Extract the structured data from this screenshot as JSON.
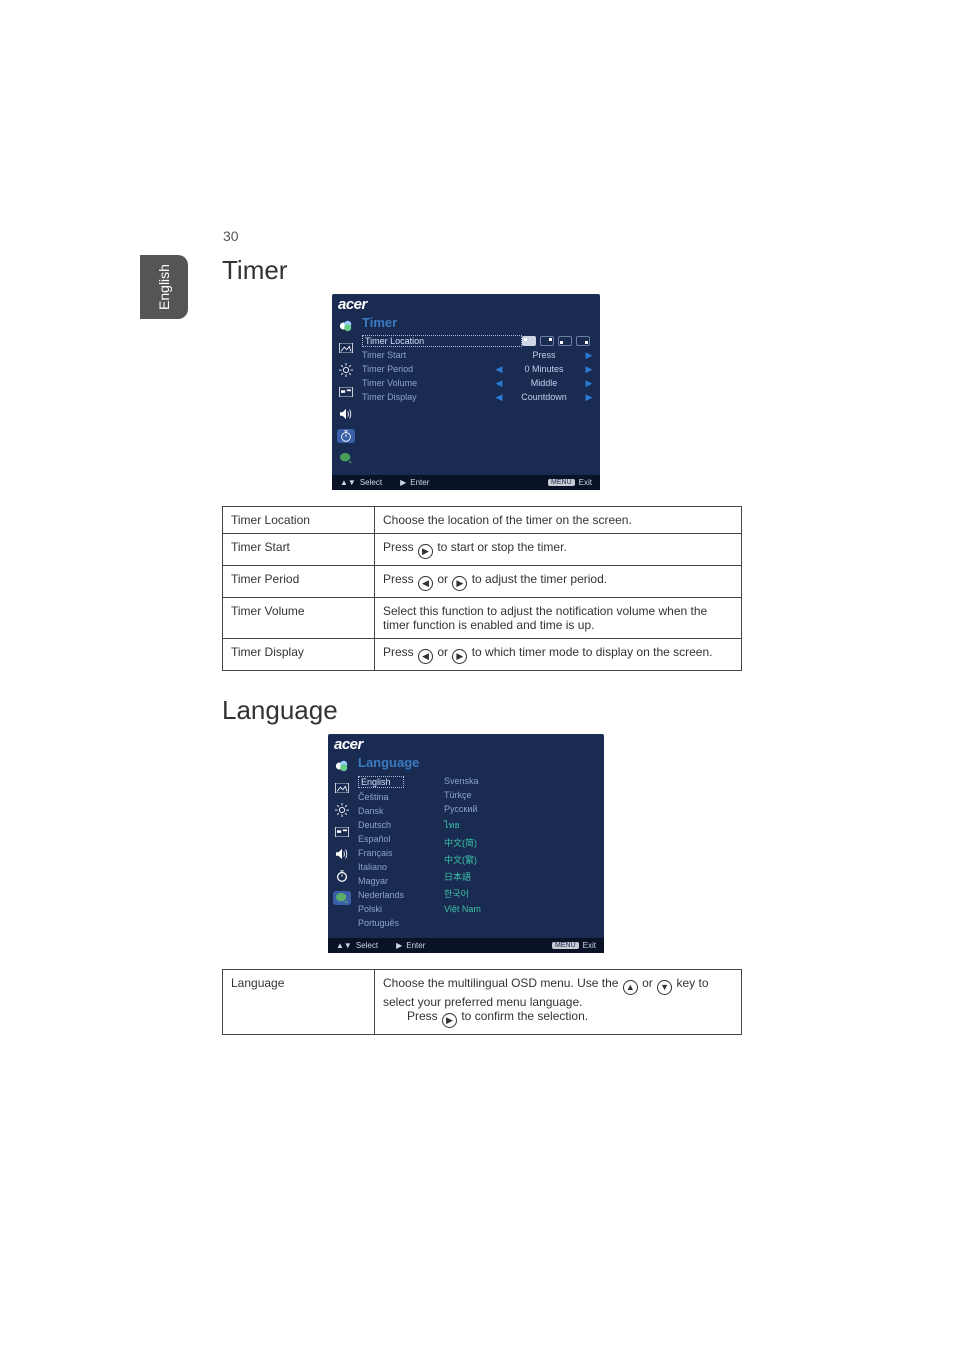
{
  "page_number": "30",
  "side_tab": "English",
  "osd_brand": "acer",
  "osd_footer": {
    "select": "Select",
    "enter": "Enter",
    "menu_badge": "MENU",
    "exit": "Exit"
  },
  "timer": {
    "heading": "Timer",
    "osd_title": "Timer",
    "rows": [
      {
        "label": "Timer Location",
        "value_type": "screens"
      },
      {
        "label": "Timer Start",
        "value": "Press",
        "arrows": false,
        "right_only": true
      },
      {
        "label": "Timer Period",
        "value": "0  Minutes",
        "arrows": true
      },
      {
        "label": "Timer Volume",
        "value": "Middle",
        "arrows": true
      },
      {
        "label": "Timer Display",
        "value": "Countdown",
        "arrows": true
      }
    ],
    "table": [
      {
        "k": "Timer Location",
        "v": "Choose the location of the timer on the screen."
      },
      {
        "k": "Timer Start",
        "v_pre": "Press ",
        "v_icon": "▶",
        "v_post": " to start or stop the timer."
      },
      {
        "k": "Timer Period",
        "v_pre": "Press ",
        "v_icon1": "◀",
        "v_mid": " or ",
        "v_icon2": "▶",
        "v_post": " to adjust the timer period."
      },
      {
        "k": "Timer Volume",
        "v": "Select this function to adjust the notification volume when the timer function is enabled and time is up."
      },
      {
        "k": "Timer Display",
        "v_pre": "Press ",
        "v_icon1": "◀",
        "v_mid": " or ",
        "v_icon2": "▶",
        "v_post": " to which timer mode to display on the screen."
      }
    ]
  },
  "language": {
    "heading": "Language",
    "osd_title": "Language",
    "col1": [
      "English",
      "Čeština",
      "Dansk",
      "Deutsch",
      "Español",
      "Français",
      "Italiano",
      "Magyar",
      "Nederlands",
      "Polski",
      "Português"
    ],
    "col2": [
      "Svenska",
      "Türkçe",
      "Русский",
      "ไทย",
      "中文(简)",
      "中文(繁)",
      "日本語",
      "한국어",
      "Việt Nam"
    ],
    "table": {
      "k": "Language",
      "line1_pre": "Choose the multilingual OSD menu. Use the ",
      "icon_up": "▲",
      "mid": " or ",
      "icon_down": "▼",
      "line1_post": " key to select your preferred menu language.",
      "line2_pre": "Press ",
      "icon_right": "▶",
      "line2_post": " to confirm the selection."
    }
  }
}
